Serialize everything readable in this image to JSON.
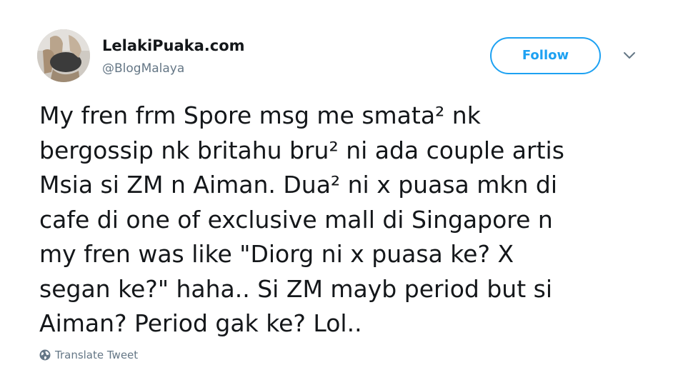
{
  "user": {
    "display_name": "LelakiPuaka.com",
    "handle": "@BlogMalaya"
  },
  "actions": {
    "follow_label": "Follow"
  },
  "tweet": {
    "lines": [
      "My fren frm Spore msg me smata² nk",
      "bergossip nk britahu bru² ni ada couple artis",
      "Msia si ZM n Aiman. Dua² ni x puasa mkn di",
      "cafe di one of exclusive mall di Singapore n",
      "my fren was like \"Diorg ni x puasa ke? X",
      "segan ke?\" haha.. Si ZM mayb period but si",
      "Aiman? Period gak ke? Lol.."
    ],
    "translate_label": "Translate Tweet"
  },
  "icons": {
    "more": "chevron-down-icon",
    "translate": "globe-icon"
  },
  "colors": {
    "accent": "#1da1f2",
    "text": "#14171a",
    "muted": "#657786"
  }
}
